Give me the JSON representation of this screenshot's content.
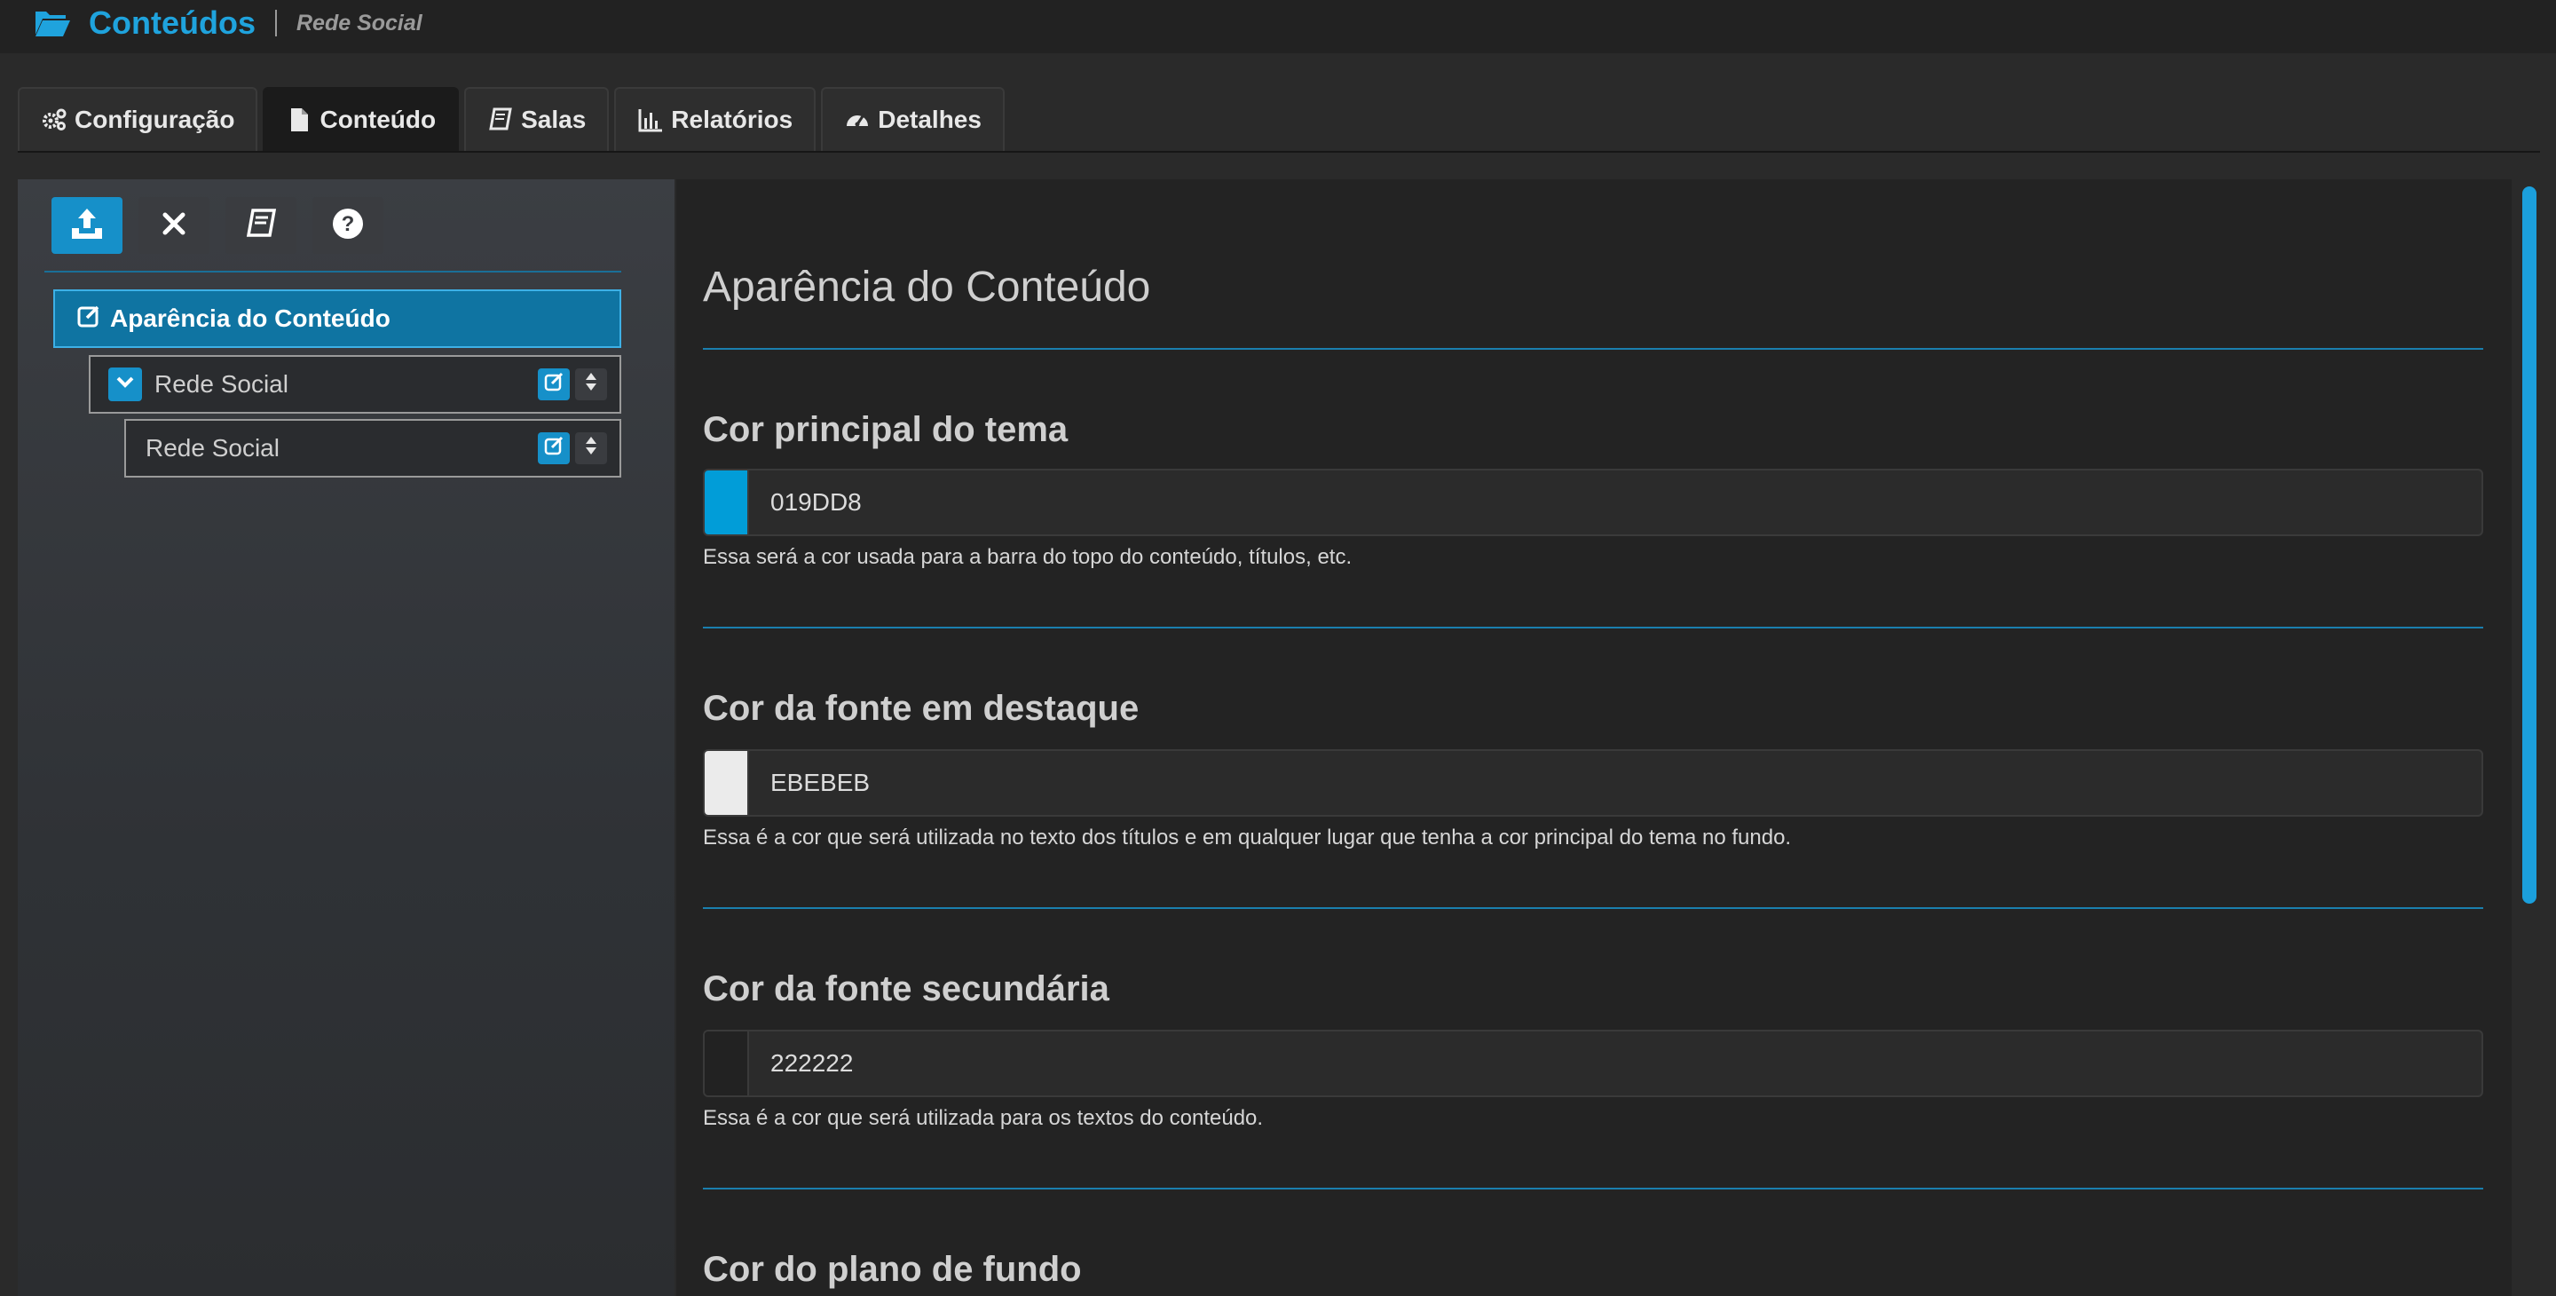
{
  "header": {
    "app_title": "Conteúdos",
    "breadcrumb": "Rede Social",
    "accent": "#1fa3dd"
  },
  "tabs": [
    {
      "label": "Configuração",
      "icon": "gears-icon"
    },
    {
      "label": "Conteúdo",
      "icon": "file-icon",
      "active": true
    },
    {
      "label": "Salas",
      "icon": "book-icon"
    },
    {
      "label": "Relatórios",
      "icon": "bar-chart-icon"
    },
    {
      "label": "Detalhes",
      "icon": "dashboard-icon"
    }
  ],
  "toolbar": {
    "buttons": [
      "upload-icon",
      "close-icon",
      "book-icon",
      "help-icon"
    ]
  },
  "tree": {
    "root": {
      "label": "Aparência do Conteúdo"
    },
    "child1": {
      "label": "Rede Social"
    },
    "child2": {
      "label": "Rede Social"
    }
  },
  "main": {
    "title": "Aparência do Conteúdo",
    "sections": [
      {
        "title": "Cor principal do tema",
        "value": "019DD8",
        "swatch": "#019DD8",
        "help": "Essa será a cor usada para a barra do topo do conteúdo, títulos, etc."
      },
      {
        "title": "Cor da fonte em destaque",
        "value": "EBEBEB",
        "swatch": "#EBEBEB",
        "help": "Essa é a cor que será utilizada no texto dos títulos e em qualquer lugar que tenha a cor principal do tema no fundo."
      },
      {
        "title": "Cor da fonte secundária",
        "value": "222222",
        "swatch": "#222222",
        "help": "Essa é a cor que será utilizada para os textos do conteúdo."
      },
      {
        "title": "Cor do plano de fundo"
      }
    ]
  }
}
